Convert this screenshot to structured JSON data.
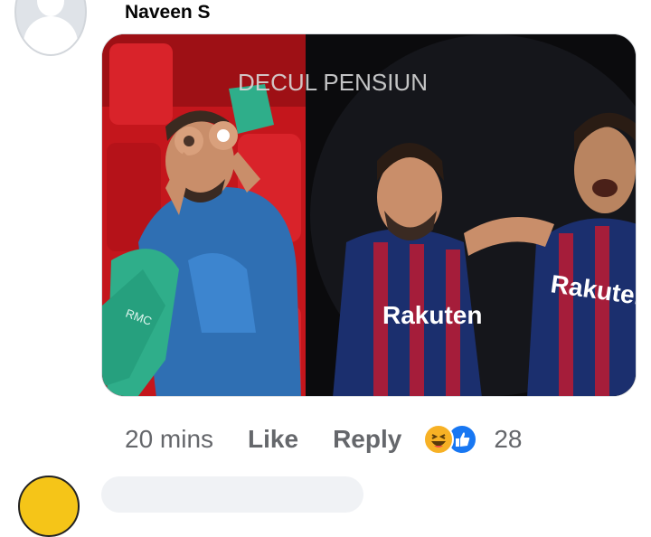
{
  "comment": {
    "author": "Naveen S",
    "image_watermark": "DECUL PENSIUN",
    "shirt_left": "RMC",
    "sponsor_text": "Rakuten",
    "time": "20 mins",
    "like_label": "Like",
    "reply_label": "Reply",
    "reaction_count": "28",
    "reaction_icons": [
      "haha-icon",
      "like-icon"
    ]
  },
  "colors": {
    "reaction_haha": "#f7b125",
    "reaction_like": "#1877f2",
    "muted_text": "#65676b",
    "author_text": "#050505"
  }
}
